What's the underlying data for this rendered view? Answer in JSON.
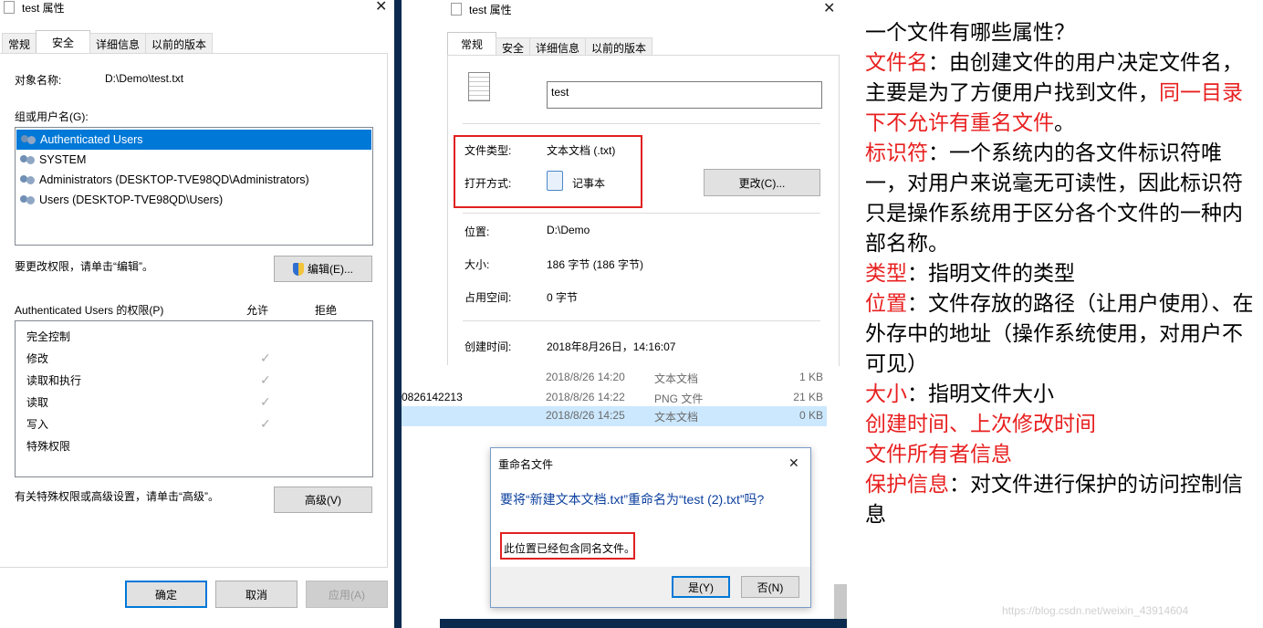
{
  "win1": {
    "title": "test 属性",
    "tabs": [
      "常规",
      "安全",
      "详细信息",
      "以前的版本"
    ],
    "object_label": "对象名称:",
    "object_value": "D:\\Demo\\test.txt",
    "group_label": "组或用户名(G):",
    "users": [
      "Authenticated Users",
      "SYSTEM",
      "Administrators (DESKTOP-TVE98QD\\Administrators)",
      "Users (DESKTOP-TVE98QD\\Users)"
    ],
    "change_hint": "要更改权限，请单击“编辑”。",
    "edit_button": "编辑(E)...",
    "perm_header": "Authenticated Users 的权限(P)",
    "allow_header": "允许",
    "deny_header": "拒绝",
    "permissions": [
      "完全控制",
      "修改",
      "读取和执行",
      "读取",
      "写入",
      "特殊权限"
    ],
    "advanced_hint": "有关特殊权限或高级设置，请单击“高级”。",
    "advanced_button": "高级(V)",
    "ok_button": "确定",
    "cancel_button": "取消",
    "apply_button": "应用(A)"
  },
  "win2": {
    "title": "test 属性",
    "tabs": [
      "常规",
      "安全",
      "详细信息",
      "以前的版本"
    ],
    "filename_value": "test",
    "type_label": "文件类型:",
    "type_value": "文本文档 (.txt)",
    "open_label": "打开方式:",
    "open_value": "记事本",
    "change_button": "更改(C)...",
    "location_label": "位置:",
    "location_value": "D:\\Demo",
    "size_label": "大小:",
    "size_value": "186 字节 (186 字节)",
    "disk_label": "占用空间:",
    "disk_value": "0 字节",
    "created_label": "创建时间:",
    "created_value": "2018年8月26日，14:16:07"
  },
  "file_list": [
    {
      "name": "",
      "date": "2018/8/26 14:20",
      "type": "文本文档",
      "size": "1 KB"
    },
    {
      "name": "0826142213",
      "date": "2018/8/26 14:22",
      "type": "PNG 文件",
      "size": "21 KB"
    },
    {
      "name": "",
      "date": "2018/8/26 14:25",
      "type": "文本文档",
      "size": "0 KB"
    }
  ],
  "rename_dialog": {
    "title": "重命名文件",
    "question": "要将“新建文本文档.txt”重命名为“test (2).txt”吗?",
    "warning": "此位置已经包含同名文件。",
    "yes_button": "是(Y)",
    "no_button": "否(N)"
  },
  "notes": {
    "heading": "一个文件有哪些属性？",
    "line1_red": "文件名",
    "line1_text": "：由创建文件的用户决定文件名，主要是为了方便用户找到文件，",
    "line1_red2": "同一目录下不允许有重名文件",
    "line1_end": "。",
    "line2_red": "标识符",
    "line2_text": "：一个系统内的各文件标识符唯一，对用户来说毫无可读性，因此标识符只是操作系统用于区分各个文件的一种内部名称。",
    "line3_red": "类型",
    "line3_text": "：指明文件的类型",
    "line4_red": "位置",
    "line4_text": "：文件存放的路径（让用户使用）、在外存中的地址（操作系统使用，对用户不可见）",
    "line5_red": "大小",
    "line5_text": "：指明文件大小",
    "line6_red": "创建时间、上次修改时间",
    "line7_red": "文件所有者信息",
    "line8_red": "保护信息",
    "line8_text": "：对文件进行保护的访问控制信息"
  },
  "watermark": "https://blog.csdn.net/weixin_43914604",
  "colors": {
    "accent": "#0078d7",
    "highlight_red": "#e02020",
    "selected_row": "#cce8ff"
  }
}
